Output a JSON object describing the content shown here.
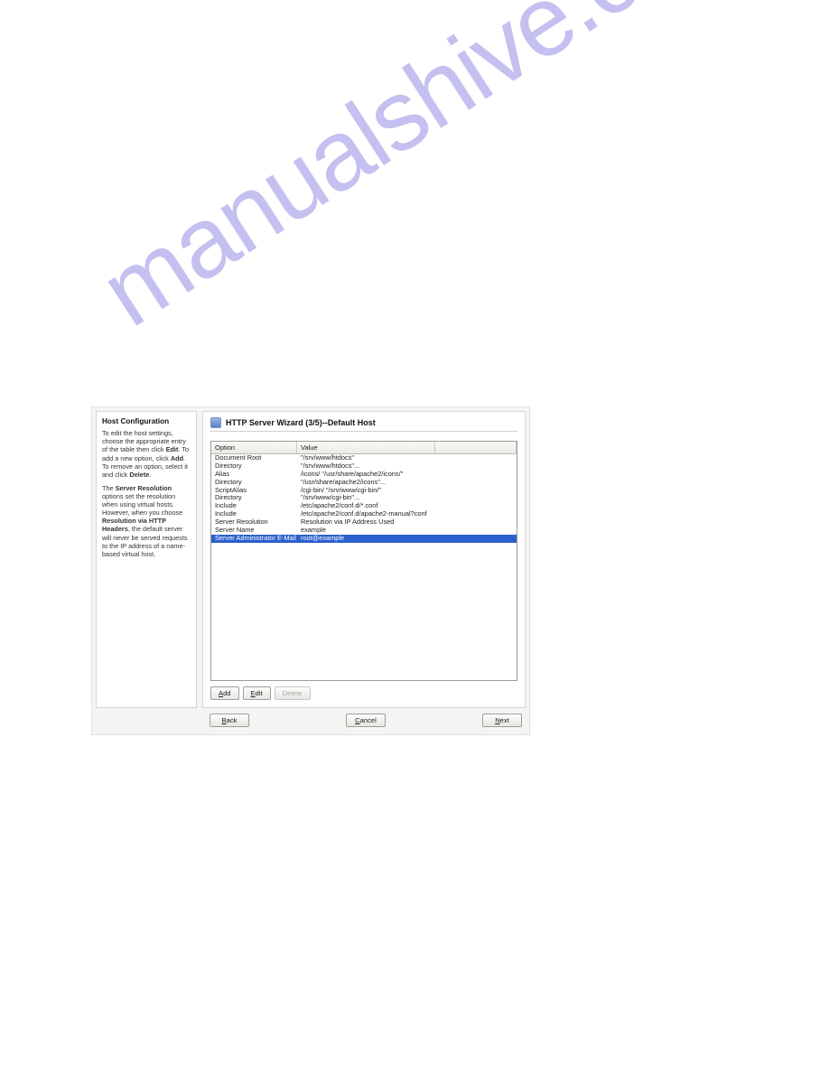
{
  "watermark": "manualshive.com",
  "sidebar": {
    "title": "Host Configuration",
    "para1_a": "To edit the host settings, choose the appropriate entry of the table then click ",
    "para1_edit": "Edit",
    "para1_b": ". To add a new option, click ",
    "para1_add": "Add",
    "para1_c": ". To remove an option, select it and click ",
    "para1_delete": "Delete",
    "para1_d": ".",
    "para2_a": "The ",
    "para2_sr": "Server Resolution",
    "para2_b": " options set the resolution when using virtual hosts. However, when you choose ",
    "para2_rvh": "Resolution via HTTP Headers",
    "para2_c": ", the default server will never be served requests to the IP address of a name-based virtual host."
  },
  "header": {
    "title": "HTTP Server Wizard (3/5)--Default Host"
  },
  "table": {
    "col_option": "Option",
    "col_value": "Value",
    "rows": [
      {
        "option": "Document Root",
        "value": "\"/srv/www/htdocs\""
      },
      {
        "option": "Directory",
        "value": "\"/srv/www/htdocs\"..."
      },
      {
        "option": "Alias",
        "value": "/icons/ \"/usr/share/apache2/icons/\""
      },
      {
        "option": "Directory",
        "value": "\"/usr/share/apache2/icons\"..."
      },
      {
        "option": "ScriptAlias",
        "value": "/cgi-bin/ \"/srv/www/cgi-bin/\""
      },
      {
        "option": "Directory",
        "value": "\"/srv/www/cgi-bin\"..."
      },
      {
        "option": "Include",
        "value": "/etc/apache2/conf.d/*.conf"
      },
      {
        "option": "Include",
        "value": "/etc/apache2/conf.d/apache2-manual?conf"
      },
      {
        "option": "Server Resolution",
        "value": "Resolution via IP Address Used"
      },
      {
        "option": "Server Name",
        "value": "example"
      },
      {
        "option": "Server Administrator E-Mail",
        "value": "root@example",
        "selected": true
      }
    ]
  },
  "buttons": {
    "add": "Add",
    "edit": "Edit",
    "delete": "Delete",
    "back": "Back",
    "cancel": "Cancel",
    "next": "Next"
  }
}
